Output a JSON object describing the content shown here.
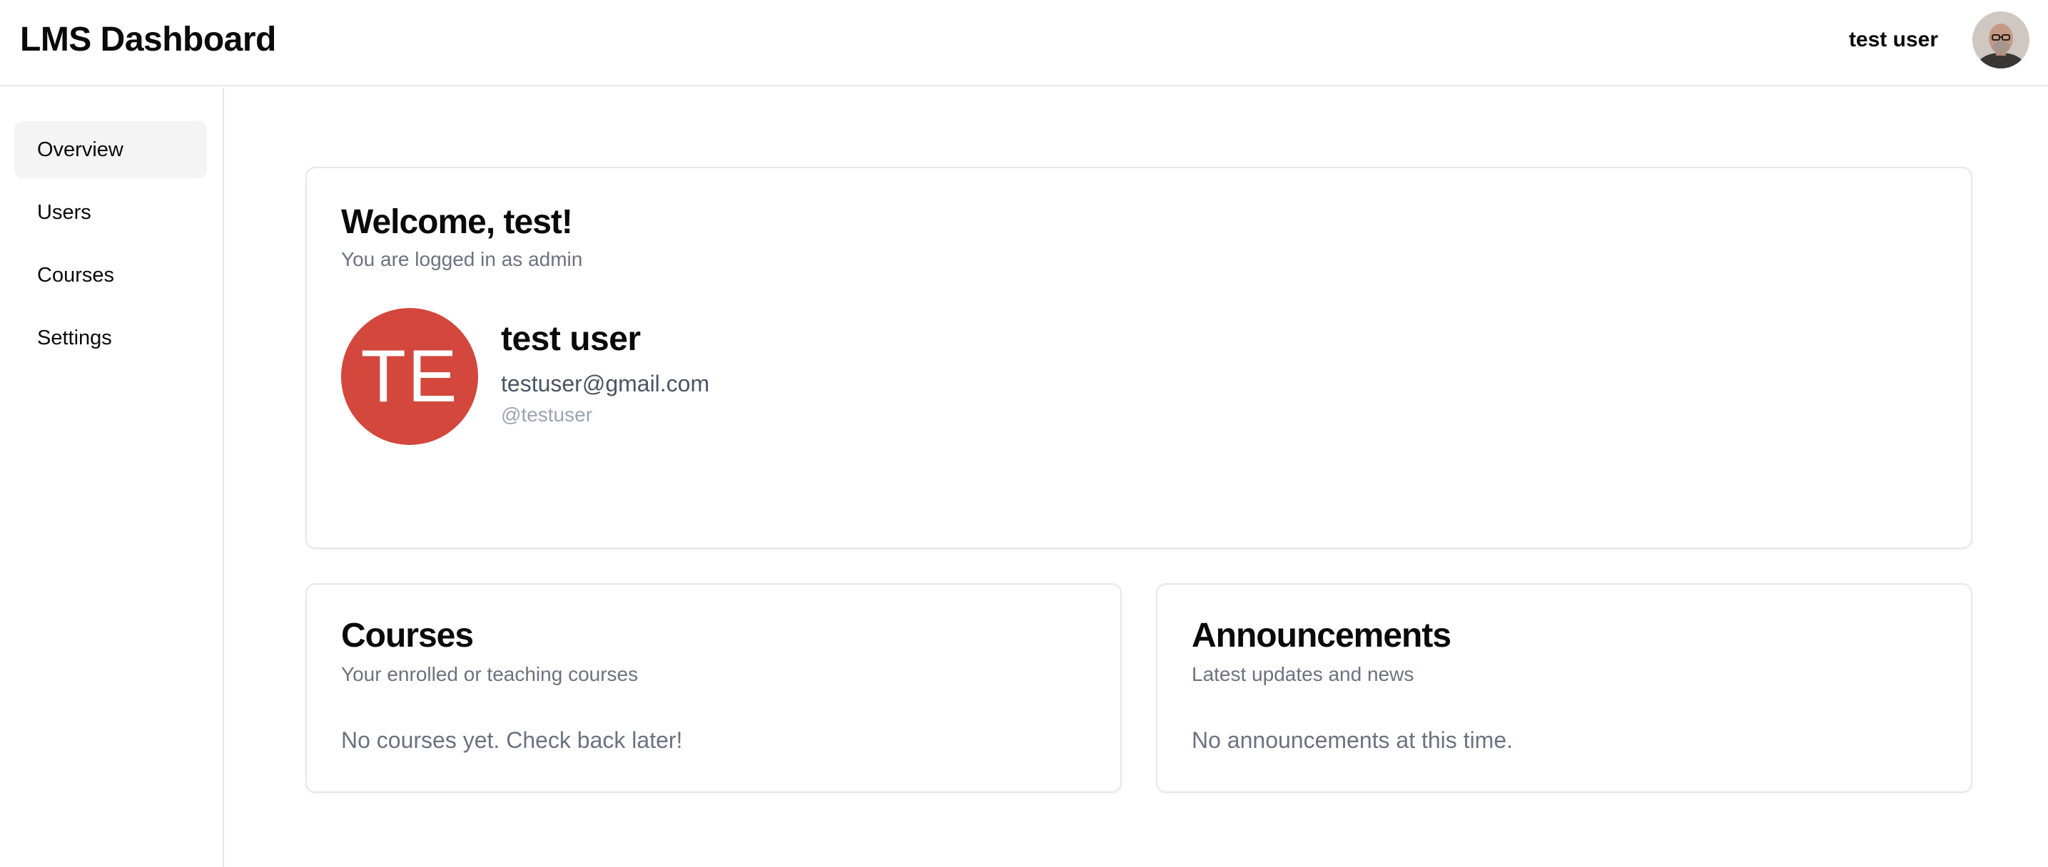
{
  "header": {
    "app_title": "LMS Dashboard",
    "user_name": "test user"
  },
  "sidebar": {
    "items": [
      {
        "label": "Overview",
        "active": true
      },
      {
        "label": "Users",
        "active": false
      },
      {
        "label": "Courses",
        "active": false
      },
      {
        "label": "Settings",
        "active": false
      }
    ]
  },
  "welcome_card": {
    "title": "Welcome, test!",
    "subtitle": "You are logged in as admin",
    "profile": {
      "initials": "TE",
      "name": "test user",
      "email": "testuser@gmail.com",
      "handle": "@testuser",
      "avatar_color": "#d3473d"
    }
  },
  "courses_card": {
    "title": "Courses",
    "subtitle": "Your enrolled or teaching courses",
    "empty_text": "No courses yet. Check back later!"
  },
  "announcements_card": {
    "title": "Announcements",
    "subtitle": "Latest updates and news",
    "empty_text": "No announcements at this time."
  },
  "colors": {
    "border": "#e5e7eb",
    "active_nav_bg": "#f4f4f5",
    "muted_text": "#6b7280"
  },
  "icons": {
    "top_avatar": "user-photo-avatar"
  }
}
